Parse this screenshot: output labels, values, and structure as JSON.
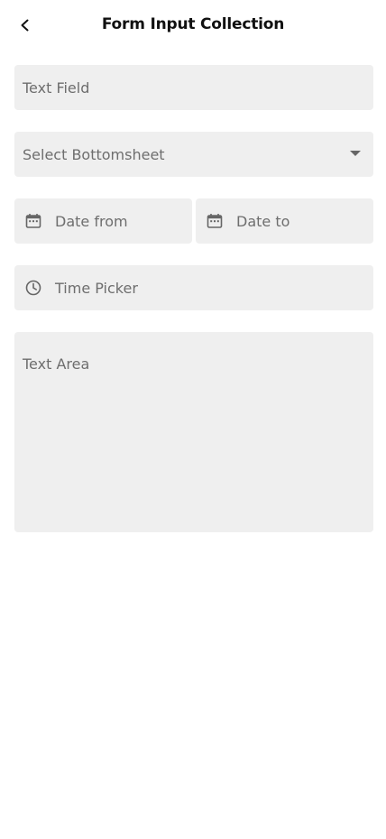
{
  "header": {
    "title": "Form Input Collection",
    "back_icon": "chevron-left-icon"
  },
  "form": {
    "text_field": {
      "placeholder": "Text Field"
    },
    "select_bottomsheet": {
      "placeholder": "Select Bottomsheet",
      "icon": "dropdown-caret-icon"
    },
    "date_from": {
      "placeholder": "Date from",
      "icon": "calendar-icon"
    },
    "date_to": {
      "placeholder": "Date to",
      "icon": "calendar-icon"
    },
    "time_picker": {
      "placeholder": "Time Picker",
      "icon": "clock-icon"
    },
    "text_area": {
      "placeholder": "Text Area"
    }
  },
  "colors": {
    "field_background": "#efefef",
    "placeholder_text": "#6e6e6e",
    "title_text": "#111111",
    "background": "#ffffff"
  }
}
